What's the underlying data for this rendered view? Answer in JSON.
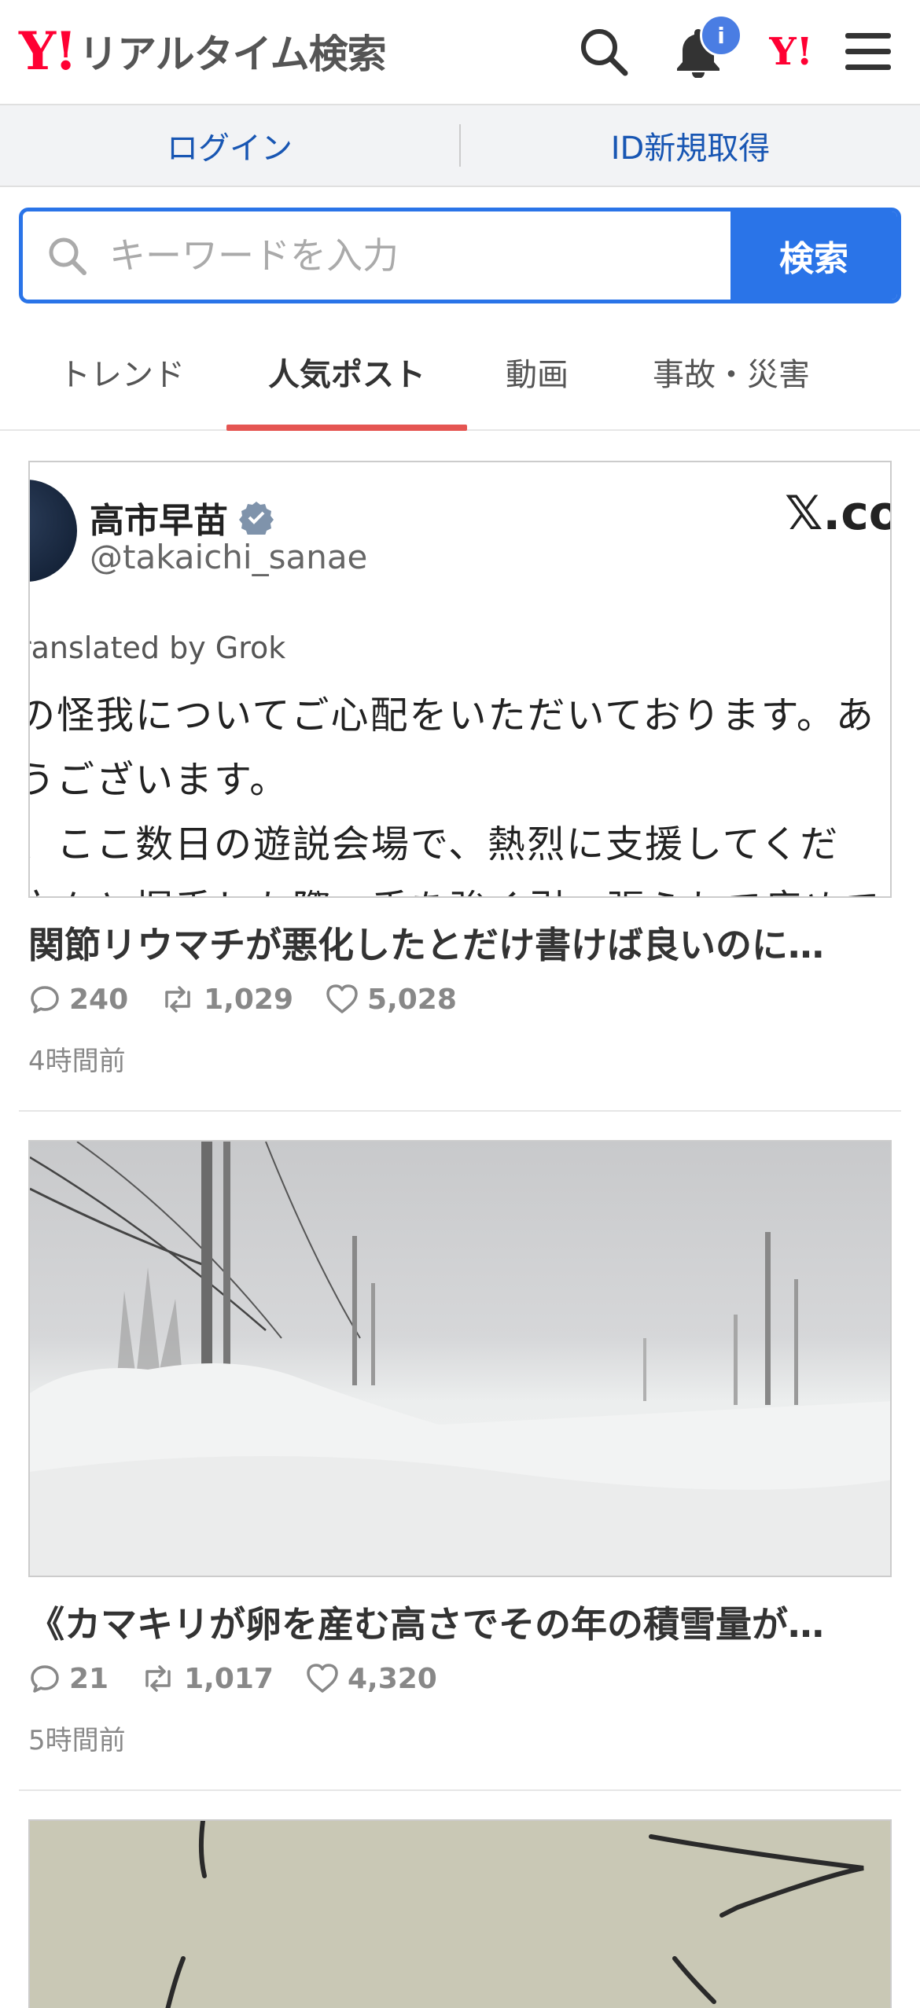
{
  "header": {
    "logo_mark": "Y!",
    "logo_text": "リアルタイム検索",
    "notification_badge": "i",
    "yahoo_mini_logo": "Y!",
    "icons": [
      "search-icon",
      "bell-icon",
      "yahoo-logo-icon",
      "hamburger-menu-icon"
    ]
  },
  "login_row": {
    "login_label": "ログイン",
    "register_label": "ID新規取得"
  },
  "search": {
    "placeholder": "キーワードを入力",
    "button_label": "検索"
  },
  "tabs": [
    {
      "label": "トレンド",
      "active": false
    },
    {
      "label": "人気ポスト",
      "active": true
    },
    {
      "label": "動画",
      "active": false
    },
    {
      "label": "事故・災害",
      "active": false
    }
  ],
  "posts": [
    {
      "title": "関節リウマチが悪化したとだけ書けば良いのに…",
      "replies": "240",
      "reposts": "1,029",
      "likes": "5,028",
      "time": "4時間前",
      "image": {
        "name": "高市早苗",
        "handle": "@takaichi_sanae",
        "brand": "𝕏.co",
        "grok": "ranslated by Grok",
        "line1": "の怪我についてご心配をいただいております。あ",
        "line2": "うございます。",
        "line3": "、ここ数日の遊説会場で、熱烈に支援してくだ",
        "line4": "方々と握手した際、手を強く引っ張られて痛めて"
      }
    },
    {
      "title": "《カマキリが卵を産む高さでその年の積雪量が…",
      "replies": "21",
      "reposts": "1,017",
      "likes": "4,320",
      "time": "5時間前"
    }
  ]
}
